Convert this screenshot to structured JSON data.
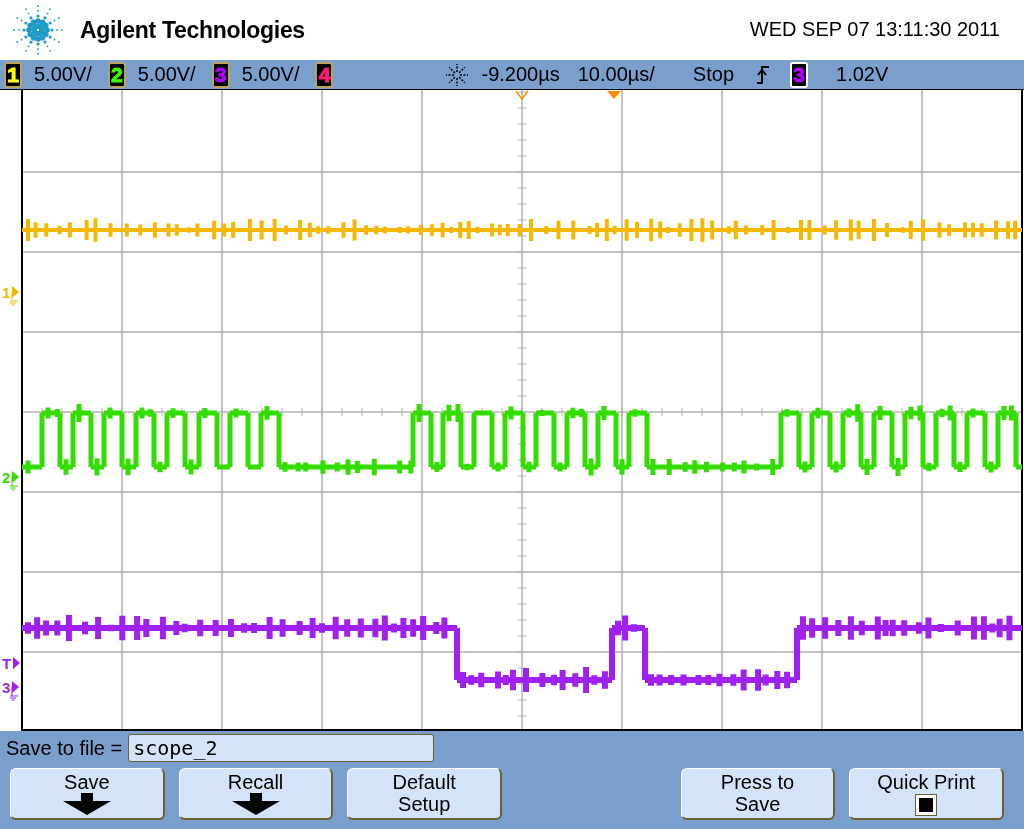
{
  "header": {
    "brand": "Agilent Technologies",
    "datetime": "WED SEP 07 13:11:30 2011"
  },
  "status_bar": {
    "channels": [
      {
        "number": "1",
        "scale": "5.00V/"
      },
      {
        "number": "2",
        "scale": "5.00V/"
      },
      {
        "number": "3",
        "scale": "5.00V/"
      },
      {
        "number": "4"
      }
    ],
    "delay": "-9.200µs",
    "timebase": "10.00µs/",
    "run_state": "Stop",
    "trigger_source": "3",
    "trigger_level": "1.02V"
  },
  "markers": [
    {
      "label": "1",
      "kind": "ground",
      "color": "#f5b800"
    },
    {
      "label": "2",
      "kind": "ground",
      "color": "#33dd00"
    },
    {
      "label": "T",
      "kind": "trigger",
      "color": "#a020f0"
    },
    {
      "label": "3",
      "kind": "ground",
      "color": "#a020f0"
    }
  ],
  "softkeys": {
    "filename_label": "Save to file =",
    "filename": "scope_2",
    "left_buttons": [
      {
        "kind": "arrow",
        "label": "Save"
      },
      {
        "kind": "arrow",
        "label": "Recall"
      },
      {
        "kind": "text",
        "label": "Default\nSetup"
      }
    ],
    "right_buttons": [
      {
        "kind": "text",
        "label": "Press to\nSave"
      },
      {
        "kind": "checkbox",
        "label": "Quick Print",
        "checked": true
      }
    ]
  }
}
